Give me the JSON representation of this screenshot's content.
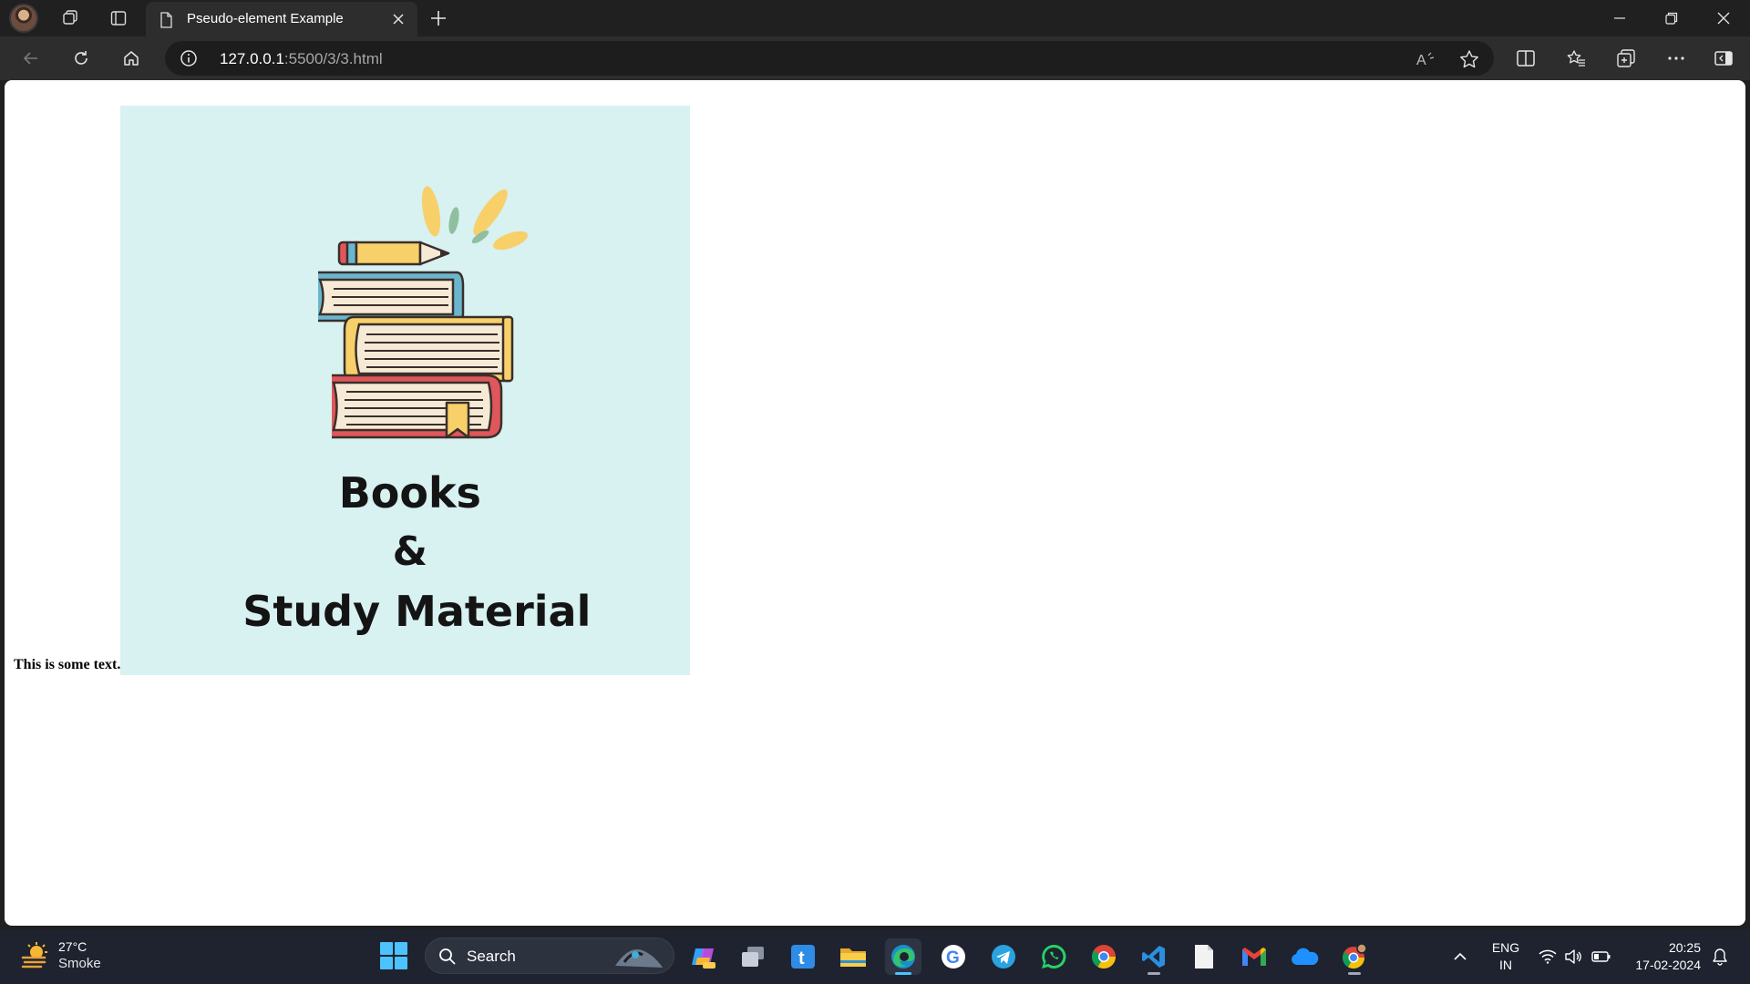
{
  "browser": {
    "tab_title": "Pseudo-element Example",
    "url_host": "127.0.0.1",
    "url_path": ":5500/3/3.html"
  },
  "page": {
    "text": "This is some text.",
    "image": {
      "line1": "Books",
      "line2": "&",
      "line3": "Study Material",
      "background": "#d8f1f1"
    }
  },
  "taskbar": {
    "weather_temp": "27°C",
    "weather_condition": "Smoke",
    "search_label": "Search",
    "lang_line1": "ENG",
    "lang_line2": "IN",
    "time": "20:25",
    "date": "17-02-2024"
  },
  "colors": {
    "accent": "#4cc2ff",
    "titlebar": "#202020",
    "toolbar": "#2d2d2d",
    "taskbar": "#1f2330"
  }
}
